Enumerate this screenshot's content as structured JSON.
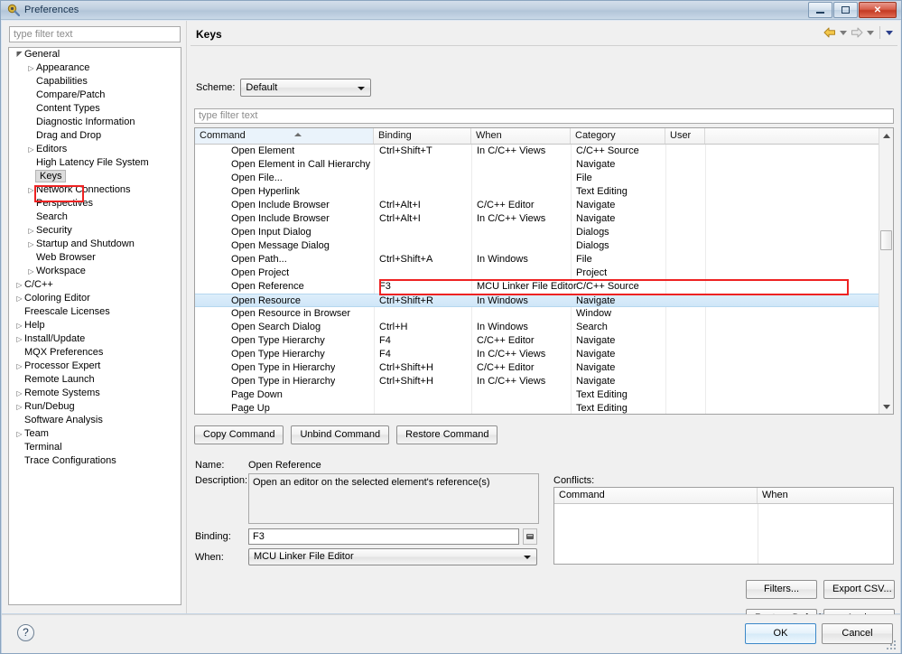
{
  "window": {
    "title": "Preferences",
    "icon": "preferences-icon",
    "minimize_label": "—",
    "maximize_label": "□",
    "close_label": "✕"
  },
  "sidebar": {
    "filter_placeholder": "type filter text",
    "filter_value": "",
    "items": [
      {
        "label": "General",
        "indent": 0,
        "twisty": "expanded",
        "selected": false
      },
      {
        "label": "Appearance",
        "indent": 1,
        "twisty": "collapsed",
        "selected": false
      },
      {
        "label": "Capabilities",
        "indent": 1,
        "twisty": "none",
        "selected": false
      },
      {
        "label": "Compare/Patch",
        "indent": 1,
        "twisty": "none",
        "selected": false
      },
      {
        "label": "Content Types",
        "indent": 1,
        "twisty": "none",
        "selected": false
      },
      {
        "label": "Diagnostic Information",
        "indent": 1,
        "twisty": "none",
        "selected": false
      },
      {
        "label": "Drag and Drop",
        "indent": 1,
        "twisty": "none",
        "selected": false
      },
      {
        "label": "Editors",
        "indent": 1,
        "twisty": "collapsed",
        "selected": false
      },
      {
        "label": "High Latency File System",
        "indent": 1,
        "twisty": "none",
        "selected": false
      },
      {
        "label": "Keys",
        "indent": 1,
        "twisty": "none",
        "selected": true
      },
      {
        "label": "Network Connections",
        "indent": 1,
        "twisty": "collapsed",
        "selected": false
      },
      {
        "label": "Perspectives",
        "indent": 1,
        "twisty": "none",
        "selected": false
      },
      {
        "label": "Search",
        "indent": 1,
        "twisty": "none",
        "selected": false
      },
      {
        "label": "Security",
        "indent": 1,
        "twisty": "collapsed",
        "selected": false
      },
      {
        "label": "Startup and Shutdown",
        "indent": 1,
        "twisty": "collapsed",
        "selected": false
      },
      {
        "label": "Web Browser",
        "indent": 1,
        "twisty": "none",
        "selected": false
      },
      {
        "label": "Workspace",
        "indent": 1,
        "twisty": "collapsed",
        "selected": false
      },
      {
        "label": "C/C++",
        "indent": 0,
        "twisty": "collapsed",
        "selected": false
      },
      {
        "label": "Coloring Editor",
        "indent": 0,
        "twisty": "collapsed",
        "selected": false
      },
      {
        "label": "Freescale Licenses",
        "indent": 0,
        "twisty": "none",
        "selected": false
      },
      {
        "label": "Help",
        "indent": 0,
        "twisty": "collapsed",
        "selected": false
      },
      {
        "label": "Install/Update",
        "indent": 0,
        "twisty": "collapsed",
        "selected": false
      },
      {
        "label": "MQX Preferences",
        "indent": 0,
        "twisty": "none",
        "selected": false
      },
      {
        "label": "Processor Expert",
        "indent": 0,
        "twisty": "collapsed",
        "selected": false
      },
      {
        "label": "Remote Launch",
        "indent": 0,
        "twisty": "none",
        "selected": false
      },
      {
        "label": "Remote Systems",
        "indent": 0,
        "twisty": "collapsed",
        "selected": false
      },
      {
        "label": "Run/Debug",
        "indent": 0,
        "twisty": "collapsed",
        "selected": false
      },
      {
        "label": "Software Analysis",
        "indent": 0,
        "twisty": "none",
        "selected": false
      },
      {
        "label": "Team",
        "indent": 0,
        "twisty": "collapsed",
        "selected": false
      },
      {
        "label": "Terminal",
        "indent": 0,
        "twisty": "none",
        "selected": false
      },
      {
        "label": "Trace Configurations",
        "indent": 0,
        "twisty": "none",
        "selected": false
      }
    ]
  },
  "page": {
    "heading": "Keys",
    "nav": {
      "back_icon": "back-arrow-icon",
      "back_menu_icon": "chevron-down-icon",
      "forward_icon": "forward-arrow-icon",
      "forward_menu_icon": "chevron-down-icon",
      "view_menu_icon": "chevron-down-icon"
    },
    "scheme": {
      "label": "Scheme:",
      "value": "Default",
      "arrow_icon": "chevron-down-icon"
    },
    "table_filter_placeholder": "type filter text",
    "table_filter_value": ""
  },
  "keys_table": {
    "columns": [
      "Command",
      "Binding",
      "When",
      "Category",
      "User",
      ""
    ],
    "sort_column": "Command",
    "sort_direction": "ascending",
    "selected_row_index": 11,
    "rows": [
      {
        "command": "Open Element",
        "binding": "Ctrl+Shift+T",
        "when": "In C/C++ Views",
        "category": "C/C++ Source",
        "user": ""
      },
      {
        "command": "Open Element in Call Hierarchy",
        "binding": "",
        "when": "",
        "category": "Navigate",
        "user": ""
      },
      {
        "command": "Open File...",
        "binding": "",
        "when": "",
        "category": "File",
        "user": ""
      },
      {
        "command": "Open Hyperlink",
        "binding": "",
        "when": "",
        "category": "Text Editing",
        "user": ""
      },
      {
        "command": "Open Include Browser",
        "binding": "Ctrl+Alt+I",
        "when": "C/C++ Editor",
        "category": "Navigate",
        "user": ""
      },
      {
        "command": "Open Include Browser",
        "binding": "Ctrl+Alt+I",
        "when": "In C/C++ Views",
        "category": "Navigate",
        "user": ""
      },
      {
        "command": "Open Input Dialog",
        "binding": "",
        "when": "",
        "category": "Dialogs",
        "user": ""
      },
      {
        "command": "Open Message Dialog",
        "binding": "",
        "when": "",
        "category": "Dialogs",
        "user": ""
      },
      {
        "command": "Open Path...",
        "binding": "Ctrl+Shift+A",
        "when": "In Windows",
        "category": "File",
        "user": ""
      },
      {
        "command": "Open Project",
        "binding": "",
        "when": "",
        "category": "Project",
        "user": ""
      },
      {
        "command": "Open Reference",
        "binding": "F3",
        "when": "MCU Linker File Editor",
        "category": "C/C++ Source",
        "user": ""
      },
      {
        "command": "Open Resource",
        "binding": "Ctrl+Shift+R",
        "when": "In Windows",
        "category": "Navigate",
        "user": ""
      },
      {
        "command": "Open Resource in Browser",
        "binding": "",
        "when": "",
        "category": "Window",
        "user": ""
      },
      {
        "command": "Open Search Dialog",
        "binding": "Ctrl+H",
        "when": "In Windows",
        "category": "Search",
        "user": ""
      },
      {
        "command": "Open Type Hierarchy",
        "binding": "F4",
        "when": "C/C++ Editor",
        "category": "Navigate",
        "user": ""
      },
      {
        "command": "Open Type Hierarchy",
        "binding": "F4",
        "when": "In C/C++ Views",
        "category": "Navigate",
        "user": ""
      },
      {
        "command": "Open Type in Hierarchy",
        "binding": "Ctrl+Shift+H",
        "when": "C/C++ Editor",
        "category": "Navigate",
        "user": ""
      },
      {
        "command": "Open Type in Hierarchy",
        "binding": "Ctrl+Shift+H",
        "when": "In C/C++ Views",
        "category": "Navigate",
        "user": ""
      },
      {
        "command": "Page Down",
        "binding": "",
        "when": "",
        "category": "Text Editing",
        "user": ""
      },
      {
        "command": "Page Up",
        "binding": "",
        "when": "",
        "category": "Text Editing",
        "user": ""
      }
    ]
  },
  "command_buttons": {
    "copy": "Copy Command",
    "unbind": "Unbind Command",
    "restore": "Restore Command"
  },
  "details": {
    "name_label": "Name:",
    "name_value": "Open Reference",
    "description_label": "Description:",
    "description_value": "Open an editor on the selected element's reference(s)",
    "binding_label": "Binding:",
    "binding_value": "F3",
    "binding_button_icon": "keybinding-icon",
    "when_label": "When:",
    "when_value": "MCU Linker File Editor",
    "when_arrow_icon": "chevron-down-icon"
  },
  "conflicts": {
    "label": "Conflicts:",
    "columns": [
      "Command",
      "When"
    ],
    "rows": []
  },
  "action_buttons": {
    "filters": "Filters...",
    "export_csv": "Export CSV...",
    "restore_defaults": "Restore Defaults",
    "apply": "Apply"
  },
  "footer": {
    "help_icon": "help-icon",
    "help_glyph": "?",
    "ok": "OK",
    "cancel": "Cancel"
  },
  "annotations": {
    "accent_color": "#ee2222",
    "boxes": [
      "scheme-row-highlight",
      "keys-tree-item-highlight",
      "open-reference-row-highlight"
    ]
  }
}
